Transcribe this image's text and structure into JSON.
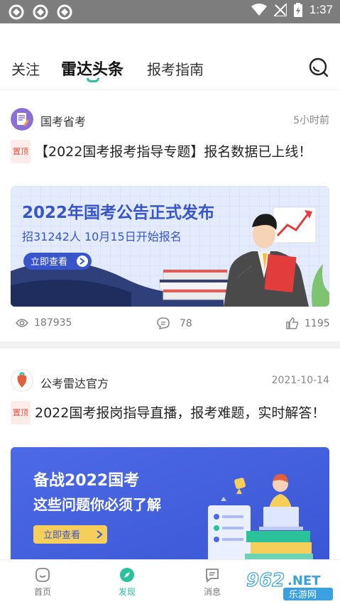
{
  "status_bar": {
    "time": "1:37"
  },
  "tabs": [
    {
      "label": "关注"
    },
    {
      "label": "雷达头条"
    },
    {
      "label": "报考指南"
    }
  ],
  "articles": [
    {
      "source": "国考省考",
      "time": "5小时前",
      "pin": "置顶",
      "title": "【2022国考报考指导专题】报名数据已上线！",
      "banner": {
        "headline": "2022年国考公告正式发布",
        "subline": "招31242人 10月15日开始报名",
        "button": "立即查看"
      },
      "views": "187935",
      "comments": "78",
      "likes": "1195"
    },
    {
      "source": "公考雷达官方",
      "time": "2021-10-14",
      "pin": "置顶",
      "title": "2022国考报岗指导直播，报考难题，实时解答！",
      "banner": {
        "headline": "备战2022国考",
        "subline": "这些问题你必须了解",
        "button": "立即查看"
      }
    }
  ],
  "bottom_nav": [
    {
      "label": "首页"
    },
    {
      "label": "发现"
    },
    {
      "label": "消息"
    }
  ],
  "watermark": {
    "brand": "962.NET",
    "sub": "乐游网"
  },
  "colors": {
    "accent": "#2bc19a",
    "pin": "#e8523f",
    "banner_blue": "#3d5bd8"
  }
}
